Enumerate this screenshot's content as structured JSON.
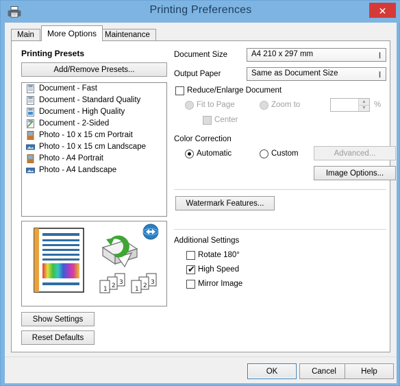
{
  "window": {
    "title": "Printing Preferences",
    "icon": "printer-icon",
    "close_label": "✕",
    "titlebar_color": "#7eb4e2",
    "close_color": "#d63a38"
  },
  "tabs": [
    {
      "label": "Main",
      "active": false
    },
    {
      "label": "More Options",
      "active": true
    },
    {
      "label": "Maintenance",
      "active": false
    }
  ],
  "presets": {
    "title": "Printing Presets",
    "add_remove_label": "Add/Remove Presets...",
    "items": [
      {
        "label": "Document - Fast",
        "icon": "document-fast-icon"
      },
      {
        "label": "Document - Standard Quality",
        "icon": "document-standard-icon"
      },
      {
        "label": "Document - High Quality",
        "icon": "document-high-quality-icon"
      },
      {
        "label": "Document - 2-Sided",
        "icon": "document-2sided-icon"
      },
      {
        "label": "Photo - 10 x 15 cm Portrait",
        "icon": "photo-portrait-icon"
      },
      {
        "label": "Photo - 10 x 15 cm Landscape",
        "icon": "photo-landscape-icon"
      },
      {
        "label": "Photo - A4 Portrait",
        "icon": "photo-portrait-icon"
      },
      {
        "label": "Photo - A4 Landscape",
        "icon": "photo-landscape-icon"
      }
    ]
  },
  "preview": {
    "page_icon": "color-document-preview-icon",
    "printer_icon": "printer-rotate-icon",
    "globe_icon": "blue-globe-arrows-icon",
    "stack_icon": "page-stack-123-icon",
    "stack_numbers": [
      "1",
      "2",
      "3"
    ]
  },
  "left_buttons": {
    "show_settings": "Show Settings",
    "reset_defaults": "Reset Defaults"
  },
  "document": {
    "size_label": "Document Size",
    "size_value": "A4 210 x 297 mm",
    "output_label": "Output Paper",
    "output_value": "Same as Document Size",
    "reduce_enlarge_label": "Reduce/Enlarge Document",
    "reduce_enlarge_checked": false,
    "fit_to_page_label": "Fit to Page",
    "fit_to_page_selected": false,
    "zoom_to_label": "Zoom to",
    "zoom_to_selected": false,
    "zoom_value": "",
    "percent_label": "%",
    "center_label": "Center",
    "center_checked": false
  },
  "color_correction": {
    "title": "Color Correction",
    "automatic_label": "Automatic",
    "automatic_selected": true,
    "custom_label": "Custom",
    "custom_selected": false,
    "advanced_label": "Advanced...",
    "advanced_disabled": true,
    "image_options_label": "Image Options..."
  },
  "watermark": {
    "button_label": "Watermark Features..."
  },
  "additional_settings": {
    "title": "Additional Settings",
    "options": [
      {
        "label": "Rotate 180°",
        "checked": false
      },
      {
        "label": "High Speed",
        "checked": true
      },
      {
        "label": "Mirror Image",
        "checked": false
      }
    ]
  },
  "footer": {
    "ok_label": "OK",
    "cancel_label": "Cancel",
    "help_label": "Help"
  }
}
